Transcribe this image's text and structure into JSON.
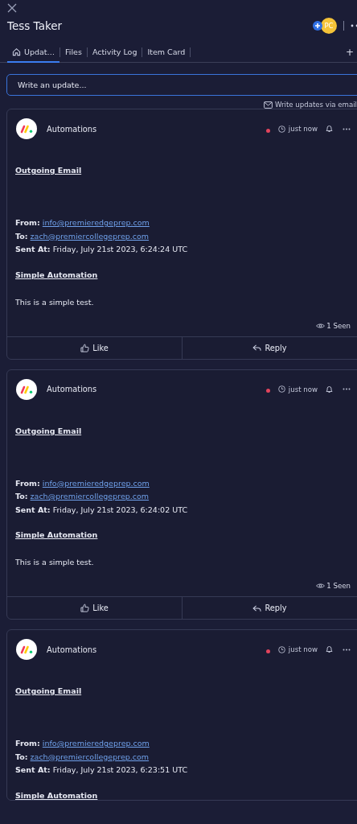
{
  "header": {
    "title": "Tess Taker",
    "avatar": "PC"
  },
  "tabs": [
    {
      "label": "Updat…",
      "selected": true
    },
    {
      "label": "Files",
      "selected": false
    },
    {
      "label": "Activity Log",
      "selected": false
    },
    {
      "label": "Item Card",
      "selected": false
    }
  ],
  "tab_add": "+",
  "composer": {
    "placeholder": "Write an update...",
    "email_link": "Write updates via email"
  },
  "updates": [
    {
      "author": "Automations",
      "unread": true,
      "time": "just now",
      "heading": "Outgoing Email",
      "from_label": "From:",
      "from": "info@premieredgeprep.com",
      "to_label": "To:",
      "to": "zach@premiercollegeprep.com",
      "sent_label": "Sent At:",
      "sent": "Friday, July 21st 2023, 6:24:24 UTC",
      "subheading": "Simple Automation",
      "body": "This is a simple test.",
      "seen": "1 Seen",
      "actions": [
        "Like",
        "Reply"
      ]
    },
    {
      "author": "Automations",
      "unread": true,
      "time": "just now",
      "heading": "Outgoing Email",
      "from_label": "From:",
      "from": "info@premieredgeprep.com",
      "to_label": "To:",
      "to": "zach@premiercollegeprep.com",
      "sent_label": "Sent At:",
      "sent": "Friday, July 21st 2023, 6:24:02 UTC",
      "subheading": "Simple Automation",
      "body": "This is a simple test.",
      "seen": "1 Seen",
      "actions": [
        "Like",
        "Reply"
      ]
    },
    {
      "author": "Automations",
      "unread": true,
      "time": "just now",
      "heading": "Outgoing Email",
      "from_label": "From:",
      "from": "info@premieredgeprep.com",
      "to_label": "To:",
      "to": "zach@premiercollegeprep.com",
      "sent_label": "Sent At:",
      "sent": "Friday, July 21st 2023, 6:23:51 UTC",
      "subheading": "Simple Automation"
    }
  ]
}
